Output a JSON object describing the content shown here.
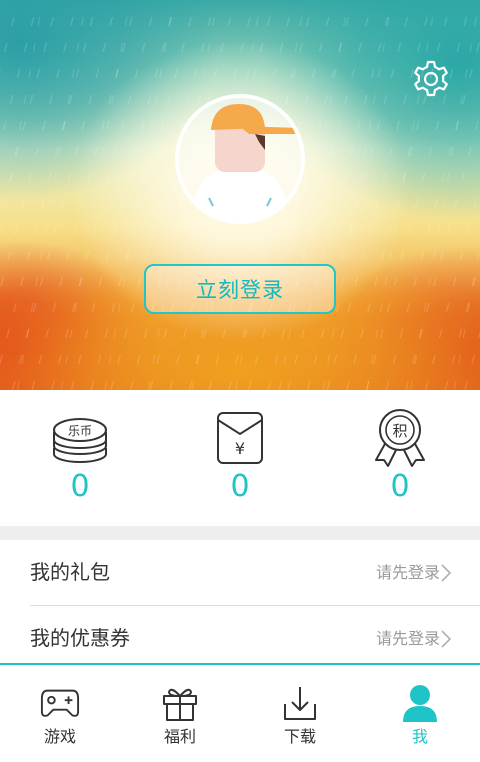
{
  "hero": {
    "login_label": "立刻登录"
  },
  "stats": [
    {
      "icon": "coin-stack-icon",
      "icon_text": "乐币",
      "value": "0"
    },
    {
      "icon": "wallet-yuan-icon",
      "icon_text": "¥",
      "value": "0"
    },
    {
      "icon": "points-badge-icon",
      "icon_text": "积",
      "value": "0"
    }
  ],
  "menu": [
    {
      "label": "我的礼包",
      "hint": "请先登录"
    },
    {
      "label": "我的优惠券",
      "hint": "请先登录"
    }
  ],
  "tabs": [
    {
      "label": "游戏",
      "icon": "gamepad-icon",
      "active": false
    },
    {
      "label": "福利",
      "icon": "gift-icon",
      "active": false
    },
    {
      "label": "下载",
      "icon": "download-icon",
      "active": false
    },
    {
      "label": "我",
      "icon": "person-icon",
      "active": true
    }
  ],
  "colors": {
    "accent": "#1fc4c8",
    "text": "#333333",
    "hint": "#9a9a9a",
    "separator": "#eeeeee"
  }
}
